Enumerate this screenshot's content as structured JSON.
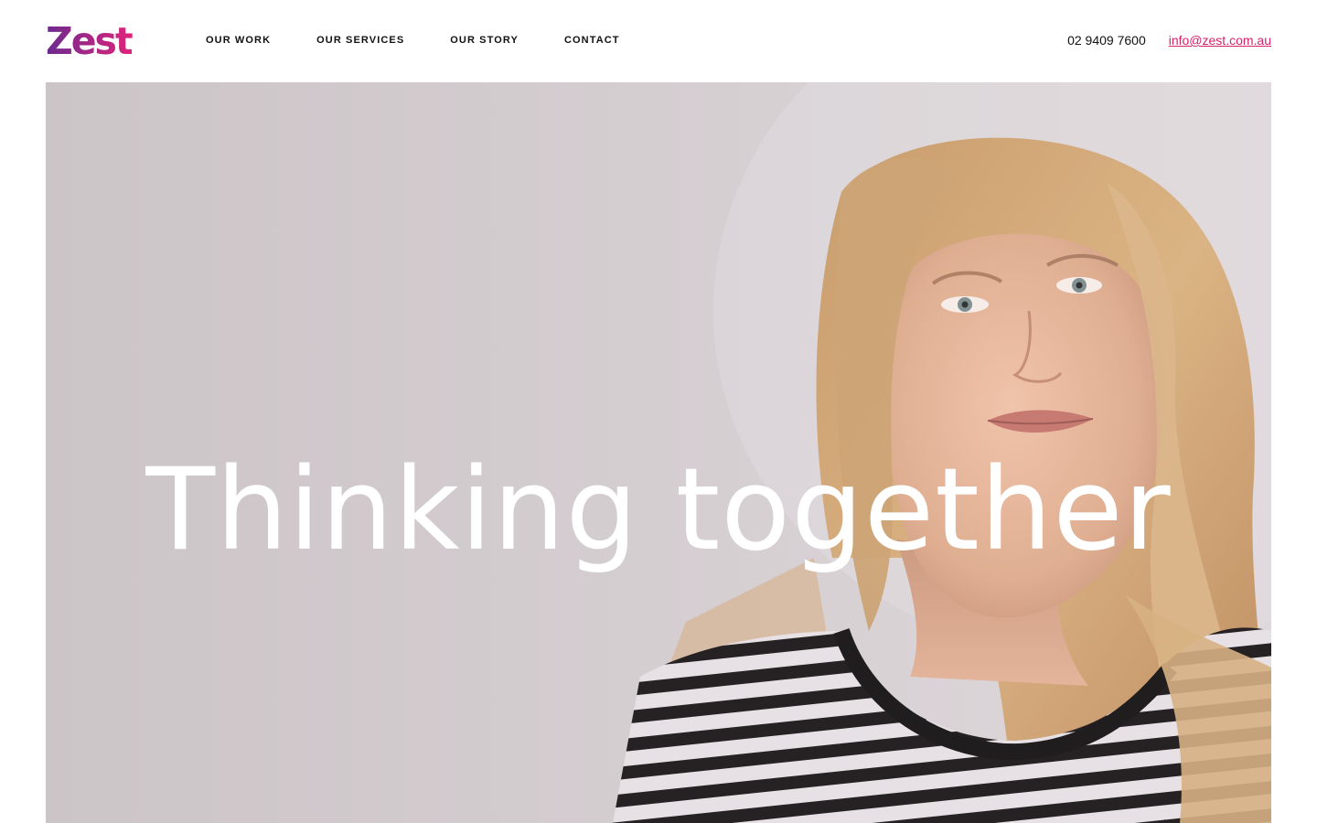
{
  "brand": {
    "name": "Zest",
    "logo_text": "Zest",
    "colors": {
      "gradient_start": "#6b2b8f",
      "gradient_end": "#e0237a",
      "accent": "#d6236b"
    }
  },
  "nav": {
    "items": [
      {
        "label": "OUR WORK"
      },
      {
        "label": "OUR SERVICES"
      },
      {
        "label": "OUR STORY"
      },
      {
        "label": "CONTACT"
      }
    ]
  },
  "contact": {
    "phone": "02 9409 7600",
    "email": "info@zest.com.au"
  },
  "hero": {
    "heading": "Thinking together",
    "image_icon": "portrait-photo-woman-striped-top"
  }
}
